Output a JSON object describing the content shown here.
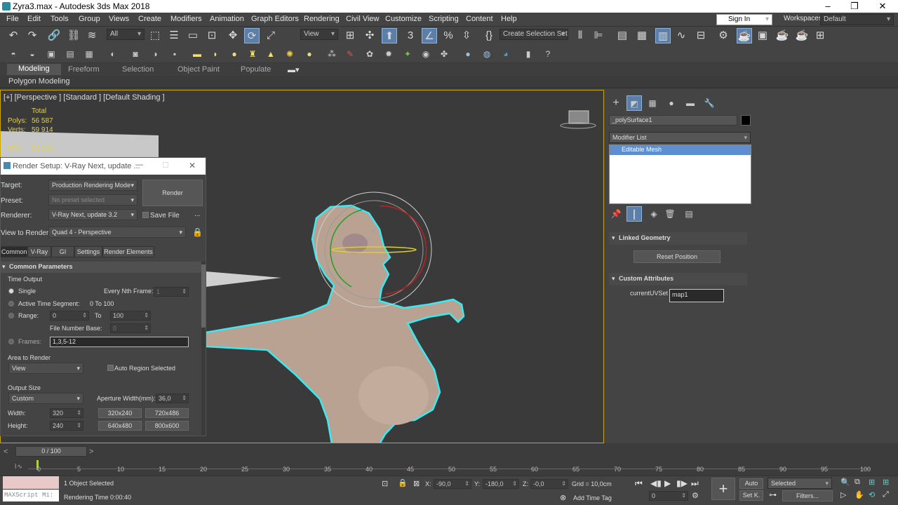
{
  "window": {
    "title": "Zyra3.max - Autodesk 3ds Max 2018"
  },
  "menus": [
    "File",
    "Edit",
    "Tools",
    "Group",
    "Views",
    "Create",
    "Modifiers",
    "Animation",
    "Graph Editors",
    "Rendering",
    "Civil View",
    "Customize",
    "Scripting",
    "Content",
    "Help"
  ],
  "menus_right": {
    "signin": "Sign In",
    "workspaces_label": "Workspaces:",
    "workspaces_value": "Default"
  },
  "toolbar": {
    "filter": "All",
    "coord_system": "View",
    "selection_set": "Create Selection Set"
  },
  "ribbon": {
    "tabs": [
      "Modeling",
      "Freeform",
      "Selection",
      "Object Paint",
      "Populate"
    ],
    "subtitle": "Polygon Modeling"
  },
  "viewport": {
    "label": "[+] [Perspective ] [Standard ] [Default Shading ]",
    "stats": {
      "total_label": "Total",
      "polys_label": "Polys:",
      "polys": "56 587",
      "verts_label": "Verts:",
      "verts": "59 914",
      "fps_label": "FPS:",
      "fps": "83,308"
    },
    "gizmo_axis": "z"
  },
  "render_setup": {
    "title": "Render Setup: V-Ray Next, update ...",
    "target_label": "Target:",
    "target": "Production Rendering Mode",
    "preset_label": "Preset:",
    "preset": "No preset selected",
    "renderer_label": "Renderer:",
    "renderer": "V-Ray Next, update 3.2",
    "savefile": "Save File",
    "dots": "...",
    "view_label": "View to Render:",
    "view": "Quad 4 - Perspective",
    "render_button": "Render",
    "tabs": [
      "Common",
      "V-Ray",
      "GI",
      "Settings",
      "Render Elements"
    ],
    "rollout": "Common Parameters",
    "time_output": "Time Output",
    "single": "Single",
    "nth_label": "Every Nth Frame:",
    "nth": "1",
    "active_seg": "Active Time Segment:",
    "active_seg_value": "0 To 100",
    "range_label": "Range:",
    "range_from": "0",
    "to_label": "To",
    "range_to": "100",
    "file_num_label": "File Number Base:",
    "file_num": "0",
    "frames_label": "Frames:",
    "frames": "1,3,5-12",
    "area_label": "Area to Render",
    "area": "View",
    "auto_region": "Auto Region Selected",
    "output_size": "Output Size",
    "size_preset": "Custom",
    "aperture_label": "Aperture Width(mm):",
    "aperture": "36,0",
    "width_label": "Width:",
    "width": "320",
    "height_label": "Height:",
    "height": "240",
    "presets": [
      "320x240",
      "720x486",
      "640x480",
      "800x600"
    ]
  },
  "command_panel": {
    "object_name": "_polySurface1",
    "modifier_list": "Modifier List",
    "stack_item": "Editable Mesh",
    "linked_geometry": "Linked Geometry",
    "reset_position": "Reset Position",
    "custom_attributes": "Custom Attributes",
    "uvset_label": "currentUVSet",
    "uvset": "map1"
  },
  "timeline": {
    "frame": "0 / 100",
    "ticks": [
      "0",
      "5",
      "10",
      "15",
      "20",
      "25",
      "30",
      "35",
      "40",
      "45",
      "50",
      "55",
      "60",
      "65",
      "70",
      "75",
      "80",
      "85",
      "90",
      "95",
      "100"
    ]
  },
  "status": {
    "script_label": "MAXScript Mi:",
    "selected": "1 Object Selected",
    "render_time": "Rendering Time  0:00:40",
    "x_label": "X:",
    "x": "-90,0",
    "y_label": "Y:",
    "y": "-180,0",
    "z_label": "Z:",
    "z": "-0,0",
    "grid": "Grid = 10,0cm",
    "add_time_tag": "Add Time Tag",
    "auto": "Auto",
    "setk": "Set K.",
    "selected_dd": "Selected",
    "filters": "Filters...",
    "frame_field": "0"
  },
  "colors": {
    "accent": "#5b7fa8",
    "viewport_border": "#c9a900",
    "selection_outline": "#3ee8f0"
  }
}
